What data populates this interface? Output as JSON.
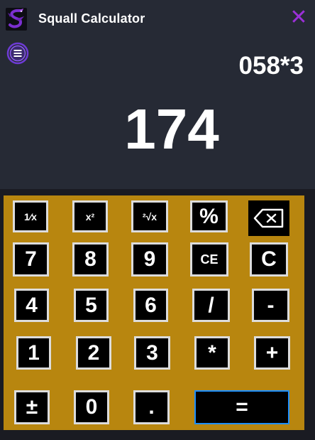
{
  "window": {
    "title": "Squall Calculator",
    "close_glyph": "✕"
  },
  "display": {
    "expression": "058*3",
    "result": "174"
  },
  "keys": {
    "reciprocal": "1⁄x",
    "square": "x²",
    "sqrt": "²√x",
    "percent": "%",
    "backspace": "backspace-icon",
    "seven": "7",
    "eight": "8",
    "nine": "9",
    "clear_entry": "CE",
    "clear": "C",
    "four": "4",
    "five": "5",
    "six": "6",
    "divide": "/",
    "minus": "-",
    "one": "1",
    "two": "2",
    "three": "3",
    "multiply": "*",
    "plus": "+",
    "negate": "±",
    "zero": "0",
    "decimal": ".",
    "equals": "="
  },
  "colors": {
    "background": "#262a35",
    "keypad": "#b8860f",
    "key": "#000000",
    "key_border": "#dcdcdc",
    "accent": "#9b30d8",
    "focus": "#1e90ff"
  },
  "icons": {
    "logo": "dragon-logo-icon",
    "menu": "menu-icon",
    "close": "close-icon"
  }
}
